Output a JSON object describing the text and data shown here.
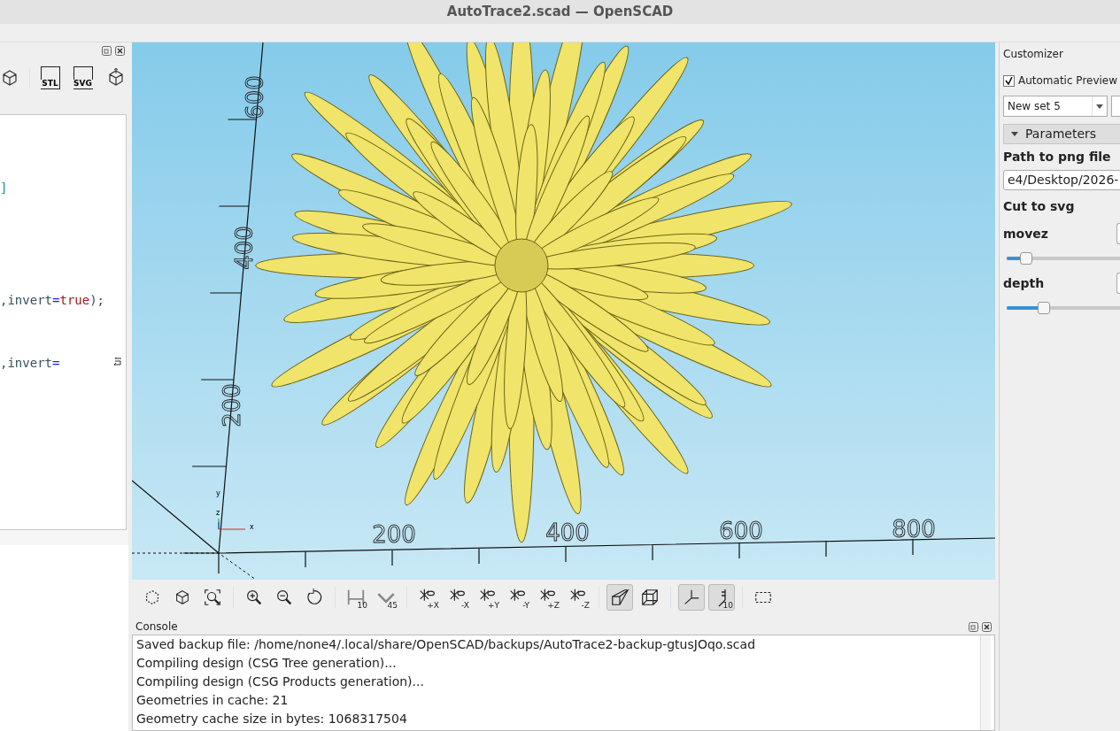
{
  "window": {
    "title": "AutoTrace2.scad — OpenSCAD"
  },
  "editor_dock": {
    "toolbar": [
      {
        "kind": "render"
      },
      {
        "kind": "export-stl",
        "label": "STL"
      },
      {
        "kind": "export-svg",
        "label": "SVG"
      },
      {
        "kind": "upload"
      }
    ],
    "code_lines": [
      {
        "wrapped": false,
        "segments": [
          {
            "text": "]",
            "kind": "bracket"
          }
        ]
      },
      {
        "wrapped": false,
        "segments": [
          {
            "text": ",invert",
            "kind": "plain"
          },
          {
            "text": "=",
            "kind": "operator"
          },
          {
            "text": "true",
            "kind": "keyword"
          },
          {
            "text": ");",
            "kind": "plain"
          }
        ]
      },
      {
        "wrapped": true,
        "segments": [
          {
            "text": ",invert",
            "kind": "plain"
          },
          {
            "text": "=",
            "kind": "operator"
          }
        ]
      }
    ]
  },
  "viewport": {
    "y_axis_labels": [
      "600",
      "400",
      "200"
    ],
    "x_axis_labels": [
      "200",
      "400",
      "600",
      "800"
    ],
    "axis_indicator_labels": [
      "y",
      "z",
      "x"
    ]
  },
  "view_toolbar": [
    {
      "kind": "preview",
      "on": false
    },
    {
      "kind": "render",
      "on": false
    },
    {
      "kind": "view-all",
      "on": false
    },
    {
      "kind": "zoom-in",
      "on": false
    },
    {
      "kind": "zoom-out",
      "on": false
    },
    {
      "kind": "reset-view",
      "on": false
    },
    {
      "kind": "measure-distance",
      "label": "10",
      "on": false
    },
    {
      "kind": "measure-angle",
      "label": "45",
      "on": false
    },
    {
      "kind": "view",
      "label": "+X",
      "on": false
    },
    {
      "kind": "view",
      "label": "-X",
      "on": false
    },
    {
      "kind": "view",
      "label": "+Y",
      "on": false
    },
    {
      "kind": "view",
      "label": "-Y",
      "on": false
    },
    {
      "kind": "view",
      "label": "+Z",
      "on": false
    },
    {
      "kind": "view",
      "label": "-Z",
      "on": false
    },
    {
      "kind": "perspective",
      "on": true
    },
    {
      "kind": "orthogonal",
      "on": false
    },
    {
      "kind": "axes",
      "on": true
    },
    {
      "kind": "scale",
      "label": "10",
      "on": true
    },
    {
      "kind": "edges",
      "on": false
    }
  ],
  "console": {
    "title": "Console",
    "lines": [
      "Saved backup file: /home/none4/.local/share/OpenSCAD/backups/AutoTrace2-backup-gtusJOqo.scad",
      "Compiling design (CSG Tree generation)...",
      "Compiling design (CSG Products generation)...",
      "Geometries in cache: 21",
      "Geometry cache size in bytes: 1068317504"
    ]
  },
  "customizer": {
    "title": "Customizer",
    "automatic_preview": {
      "label": "Automatic Preview",
      "checked": true
    },
    "preset": "New set 5",
    "section": {
      "title": "Parameters",
      "expanded": true
    },
    "parameters": [
      {
        "kind": "text",
        "label": "Path to png file",
        "value": "e4/Desktop/2026-"
      },
      {
        "kind": "label",
        "label": "Cut to svg"
      },
      {
        "kind": "slider",
        "label": "movez",
        "level": 0.17
      },
      {
        "kind": "slider",
        "label": "depth",
        "level": 0.33
      }
    ]
  }
}
